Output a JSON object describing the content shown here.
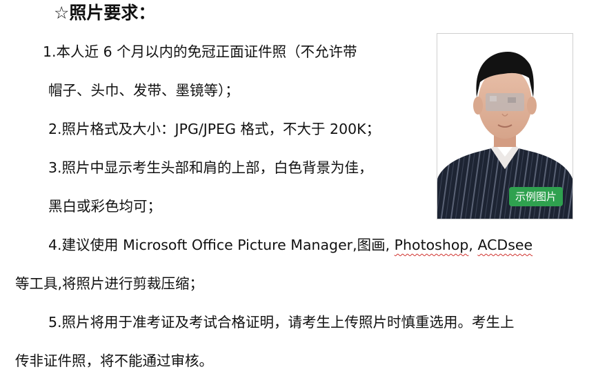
{
  "heading": "☆照片要求：",
  "items": {
    "item1_line1": "1.本人近 6 个月以内的免冠正面证件照（不允许带",
    "item1_line2": "帽子、头巾、发带、墨镜等）；",
    "item2": "2.照片格式及大小：JPG/JPEG 格式，不大于 200K；",
    "item3_line1": "3.照片中显示考生头部和肩的上部，白色背景为佳，",
    "item3_line2": "黑白或彩色均可；",
    "item4_line1_prefix": "4.建议使用 Microsoft Office Picture Manager,图画, ",
    "item4_line1_word1": "Photoshop",
    "item4_line1_sep": ", ",
    "item4_line1_word2": "ACDsee",
    "item4_line2": "等工具,将照片进行剪裁压缩；",
    "item5_line1": "5.照片将用于准考证及考试合格证明，请考生上传照片时慎重选用。考生上",
    "item5_line2": "传非证件照，将不能通过审核。"
  },
  "sample_photo": {
    "badge_label": "示例图片"
  },
  "colors": {
    "text": "#111111",
    "badge": "#2fa14f",
    "spellcheck_underline": "#d0312d"
  }
}
